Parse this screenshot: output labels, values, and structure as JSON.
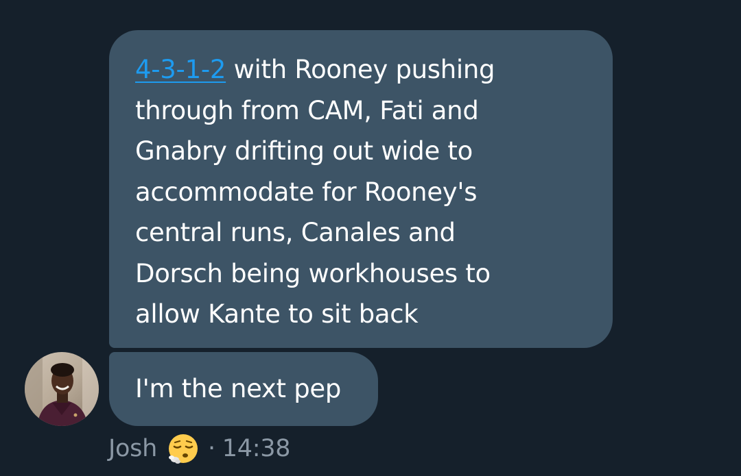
{
  "messages": [
    {
      "link_text": "4-3-1-2",
      "lines": [
        " with Rooney pushing",
        "through from CAM, Fati and",
        "Gnabry drifting out wide to",
        "accommodate for Rooney's",
        "central runs, Canales and",
        "Dorsch being workhouses to",
        "allow Kante to sit back"
      ]
    },
    {
      "text": "I'm the next pep"
    }
  ],
  "sender": {
    "name": "Josh",
    "emoji_icon": "relieved-face-exhaling-icon",
    "separator": "·",
    "time": "14:38"
  },
  "colors": {
    "background": "#15202b",
    "bubble": "#3d5466",
    "link": "#1d9bf0",
    "meta_text": "#8b98a5"
  }
}
